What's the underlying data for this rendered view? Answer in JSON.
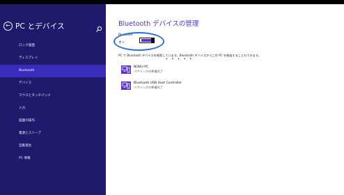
{
  "sidebar": {
    "title": "PC とデバイス",
    "back_icon": "back-arrow-icon",
    "search_icon": "search-icon",
    "items": [
      {
        "label": "ロック画面"
      },
      {
        "label": "ディスプレイ"
      },
      {
        "label": "Bluetooth",
        "selected": true
      },
      {
        "label": "デバイス"
      },
      {
        "label": "マウスとタッチパッド"
      },
      {
        "label": "入力"
      },
      {
        "label": "画面の操作"
      },
      {
        "label": "電源とスリープ"
      },
      {
        "label": "自動再生"
      },
      {
        "label": "PC 情報"
      }
    ]
  },
  "main": {
    "title": "Bluetooth デバイスの管理",
    "bluetooth_label": "Bluetooth",
    "toggle_state_label": "オン",
    "toggle_on": true,
    "status_text": "PC で Bluetooth デバイスを検索しています。Bluetooth デバイスからこの PC を検出することもできます。",
    "busy_dots": "• • • • •",
    "devices": [
      {
        "name": "NOBU-PC",
        "status": "ペアリングの準備完了",
        "icon": "bluetooth-device-icon"
      },
      {
        "name": "Bluetooth USB Host Controller",
        "status": "ペアリングの準備完了",
        "icon": "bluetooth-device-icon"
      }
    ]
  },
  "colors": {
    "sidebar_bg": "#1f1a6b",
    "sidebar_selected": "#3a2dbd",
    "accent": "#5b2fd0",
    "highlight_ring": "#2a6fd8"
  }
}
